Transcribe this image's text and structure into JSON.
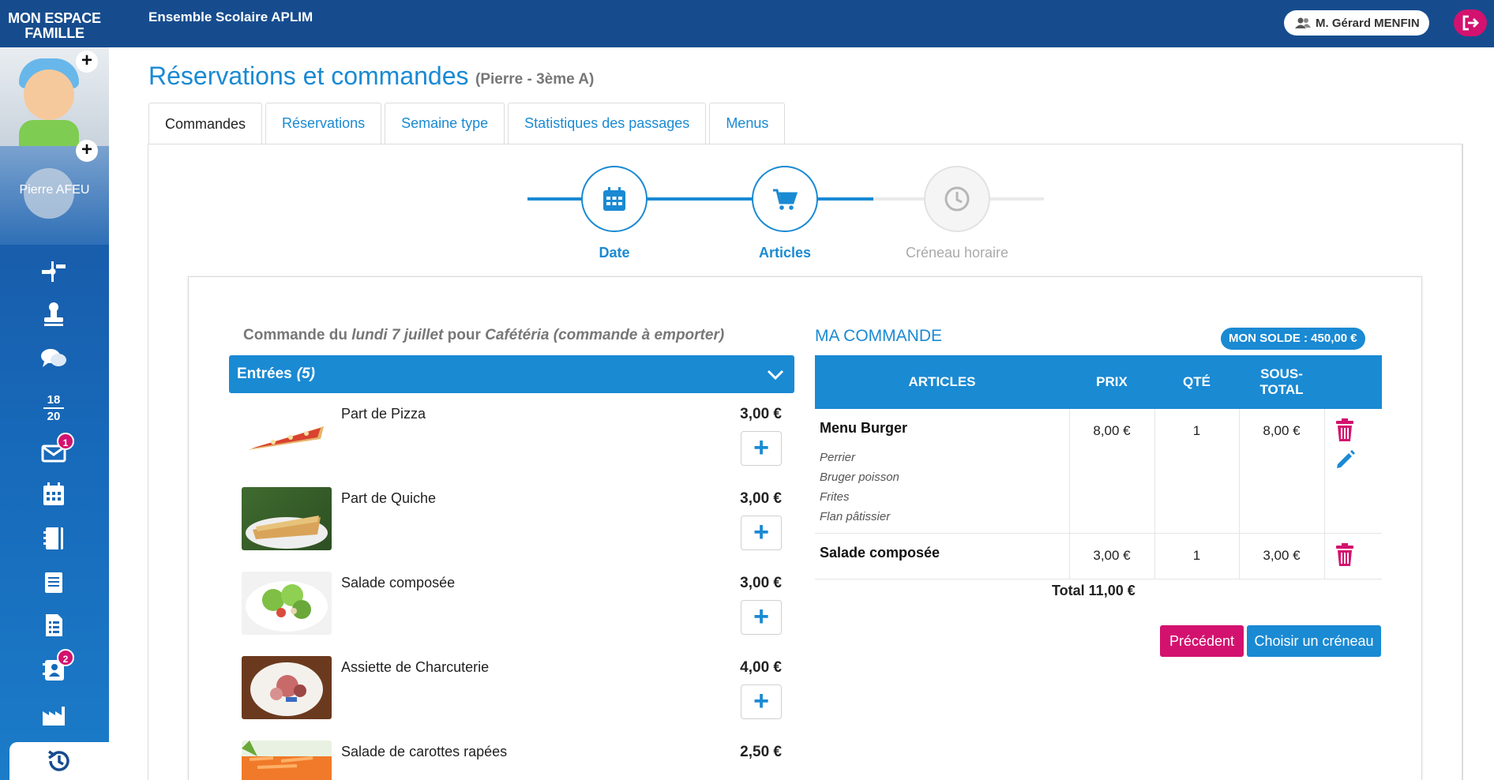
{
  "brand": {
    "line1": "MON ESPACE",
    "line2": "FAMILLE"
  },
  "sidebar": {
    "child_name": "Pierre AFEU",
    "plus_label": "+",
    "icons": [
      {
        "name": "timeline-icon"
      },
      {
        "name": "stamp-icon"
      },
      {
        "name": "chat-icon"
      },
      {
        "name": "grades-icon",
        "top": "18",
        "bottom": "20"
      },
      {
        "name": "mail-icon",
        "badge": "1"
      },
      {
        "name": "calendar-icon"
      },
      {
        "name": "notebook-icon"
      },
      {
        "name": "book-icon"
      },
      {
        "name": "document-list-icon"
      },
      {
        "name": "contacts-icon",
        "badge": "2"
      },
      {
        "name": "factory-icon"
      }
    ],
    "bottom_icon": "history-icon"
  },
  "topbar": {
    "school": "Ensemble Scolaire APLIM",
    "user": "M. Gérard MENFIN",
    "logout_icon": "logout-icon"
  },
  "page": {
    "title": "Réservations et commandes",
    "subtitle": "(Pierre - 3ème A)"
  },
  "tabs": [
    "Commandes",
    "Réservations",
    "Semaine type",
    "Statistiques des passages",
    "Menus"
  ],
  "stepper": [
    {
      "label": "Date",
      "icon": "calendar-icon",
      "state": "done"
    },
    {
      "label": "Articles",
      "icon": "cart-icon",
      "state": "current"
    },
    {
      "label": "Créneau horaire",
      "icon": "clock-icon",
      "state": "todo"
    }
  ],
  "order": {
    "prefix": "Commande du",
    "date": "lundi 7 juillet",
    "middle": "pour",
    "place": "Cafétéria (commande à emporter)"
  },
  "category": {
    "label": "Entrées",
    "count": "(5)"
  },
  "items": [
    {
      "name": "Part de Pizza",
      "price": "3,00 €"
    },
    {
      "name": "Part de Quiche",
      "price": "3,00 €"
    },
    {
      "name": "Salade composée",
      "price": "3,00 €"
    },
    {
      "name": "Assiette de Charcuterie",
      "price": "4,00 €"
    },
    {
      "name": "Salade de carottes rapées",
      "price": "2,50 €"
    }
  ],
  "add_label": "+",
  "cart": {
    "title": "MA COMMANDE",
    "solde": "MON SOLDE : 450,00 €",
    "headers": {
      "articles": "ARTICLES",
      "prix": "PRIX",
      "qte": "QTÉ",
      "sous_total_1": "SOUS-",
      "sous_total_2": "TOTAL"
    },
    "rows": [
      {
        "name": "Menu Burger",
        "price": "8,00 €",
        "qty": "1",
        "subtotal": "8,00 €",
        "options": [
          "Perrier",
          "Bruger poisson",
          "Frites",
          "Flan pâtissier"
        ]
      },
      {
        "name": "Salade composée",
        "price": "3,00 €",
        "qty": "1",
        "subtotal": "3,00 €"
      }
    ],
    "total": "Total 11,00 €"
  },
  "buttons": {
    "prev": "Précédent",
    "next": "Choisir un créneau"
  },
  "colors": {
    "primary": "#1a8ad3",
    "navy": "#164c8e",
    "accent": "#d3126f"
  }
}
